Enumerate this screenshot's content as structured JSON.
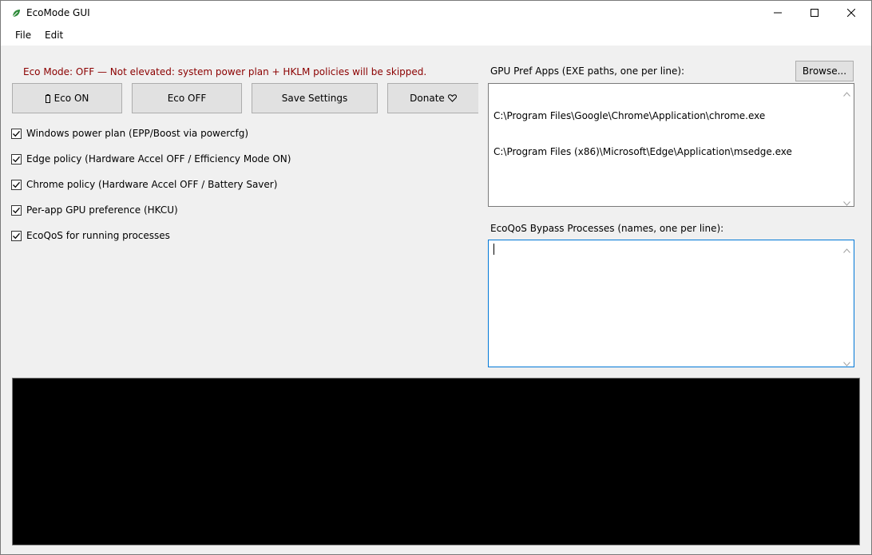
{
  "window": {
    "title": "EcoMode GUI",
    "app_icon": "leaf-icon",
    "controls": [
      "minimize-icon",
      "maximize-icon",
      "close-icon"
    ]
  },
  "menu": {
    "file": "File",
    "edit": "Edit"
  },
  "status": {
    "text": "Eco Mode: OFF — Not elevated: system power plan + HKLM policies will be skipped.",
    "color": "#8b0000"
  },
  "buttons": {
    "eco_on": "Eco ON",
    "eco_on_icon": "battery-icon",
    "eco_off": "Eco OFF",
    "save": "Save Settings",
    "donate": "Donate",
    "donate_icon": "heart-icon"
  },
  "options": [
    {
      "label": "Windows power plan (EPP/Boost via powercfg)",
      "checked": true
    },
    {
      "label": "Edge policy (Hardware Accel OFF / Efficiency Mode ON)",
      "checked": true
    },
    {
      "label": "Chrome policy (Hardware Accel OFF / Battery Saver)",
      "checked": true
    },
    {
      "label": "Per-app GPU preference (HKCU)",
      "checked": true
    },
    {
      "label": "EcoQoS for running processes",
      "checked": true
    }
  ],
  "gpu_pref": {
    "label": "GPU Pref Apps (EXE paths, one per line):",
    "browse": "Browse...",
    "lines": [
      "C:\\Program Files\\Google\\Chrome\\Application\\chrome.exe",
      "C:\\Program Files (x86)\\Microsoft\\Edge\\Application\\msedge.exe"
    ]
  },
  "ecoqos_bypass": {
    "label": "EcoQoS Bypass Processes (names, one per line):",
    "value": ""
  },
  "colors": {
    "console_bg": "#000000",
    "focus_border": "#0078d7"
  }
}
